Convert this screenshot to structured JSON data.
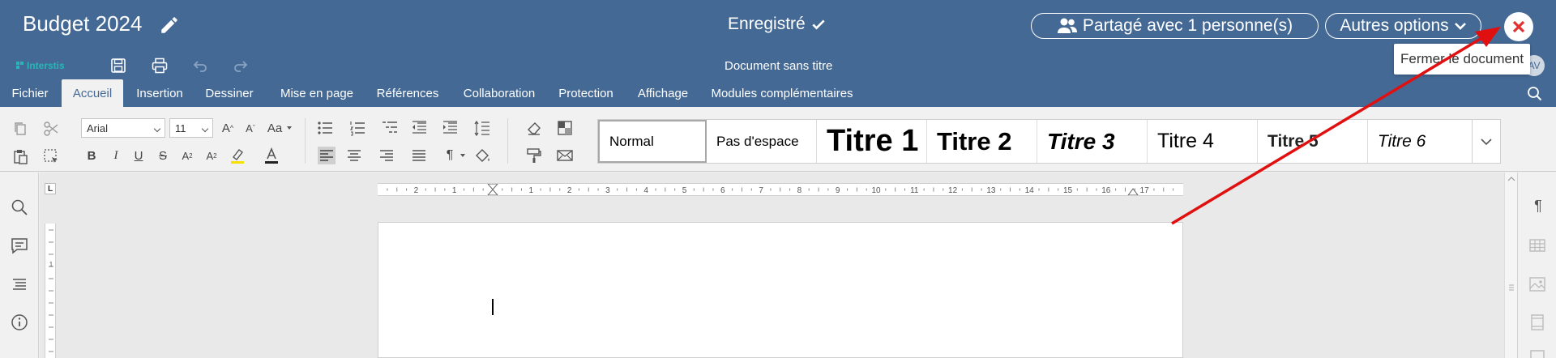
{
  "header": {
    "doc_title": "Budget 2024",
    "saved_status": "Enregistré",
    "share_label": "Partagé avec 1 personne(s)",
    "more_options_label": "Autres options",
    "close_tooltip": "Fermer le document"
  },
  "subbar": {
    "brand": "Interstis",
    "document_name": "Document sans titre",
    "avatar_initials": "AV"
  },
  "tabs": [
    "Fichier",
    "Accueil",
    "Insertion",
    "Dessiner",
    "Mise en page",
    "Références",
    "Collaboration",
    "Protection",
    "Affichage",
    "Modules complémentaires"
  ],
  "active_tab": "Accueil",
  "ribbon": {
    "font_name": "Arial",
    "font_size": "11",
    "styles": [
      "Normal",
      "Pas d'espace",
      "Titre 1",
      "Titre 2",
      "Titre 3",
      "Titre 4",
      "Titre 5",
      "Titre 6"
    ]
  },
  "ruler": {
    "h_numbers": [
      "2",
      "1",
      "1",
      "2",
      "3",
      "4",
      "5",
      "6",
      "7",
      "8",
      "9",
      "10",
      "11",
      "12",
      "13",
      "14",
      "15",
      "16",
      "17"
    ],
    "v_numbers": [
      "1"
    ]
  },
  "colors": {
    "header_bg": "#446995",
    "accent_close": "#e03030",
    "annotation_arrow": "#e01010",
    "brand_teal": "#29b6b6"
  }
}
